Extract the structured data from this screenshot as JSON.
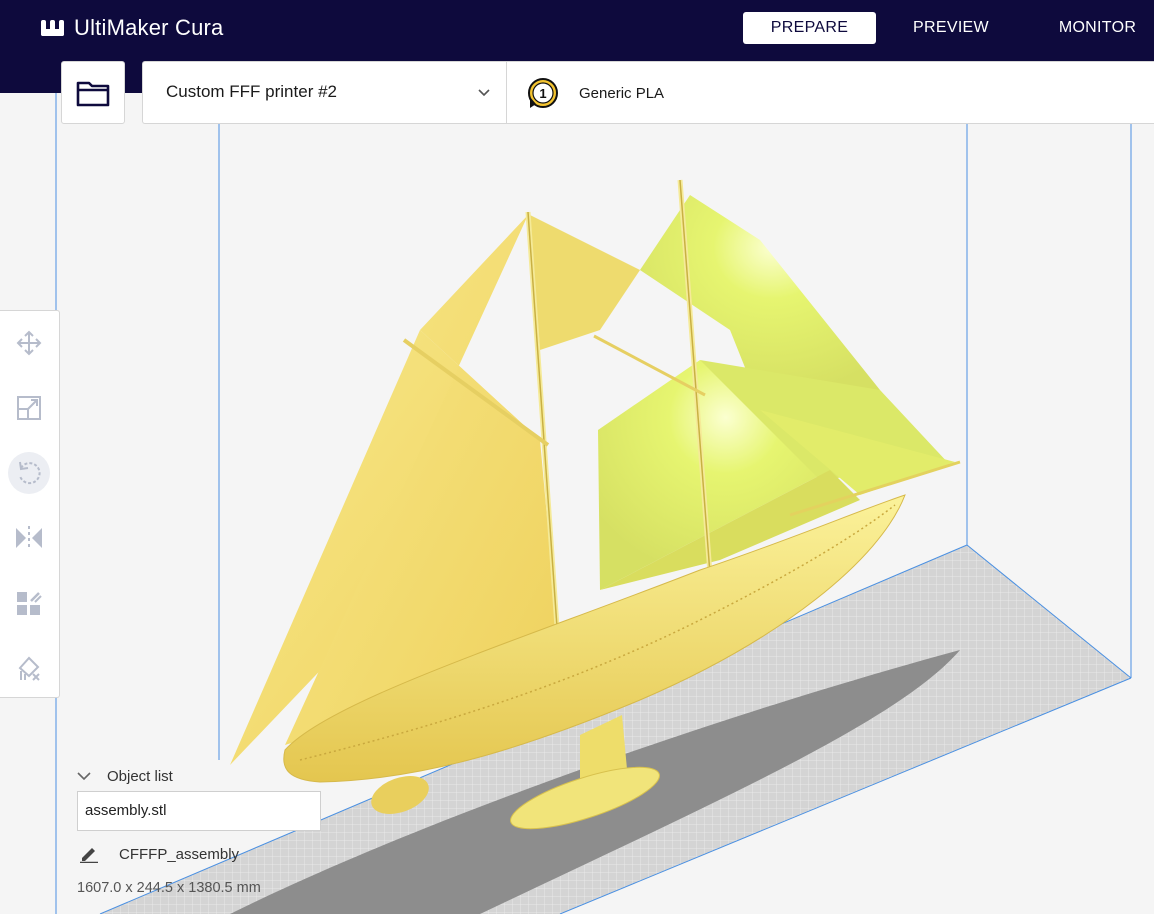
{
  "app": {
    "logo_text": "UltiMaker Cura",
    "logo_icon": "ultimaker-logo-icon"
  },
  "stages": [
    {
      "label": "PREPARE",
      "active": true
    },
    {
      "label": "PREVIEW",
      "active": false
    },
    {
      "label": "MONITOR",
      "active": false
    }
  ],
  "toolbar_top": {
    "open_icon": "folder-icon",
    "printer": {
      "name": "Custom FFF printer #2",
      "icon": "chevron-down-icon"
    },
    "material": {
      "extruder_number": "1",
      "name": "Generic PLA"
    }
  },
  "left_tools": [
    {
      "icon": "move-icon"
    },
    {
      "icon": "scale-icon"
    },
    {
      "icon": "rotate-icon",
      "selected": true
    },
    {
      "icon": "mirror-icon"
    },
    {
      "icon": "per-model-settings-icon"
    },
    {
      "icon": "support-blocker-icon"
    }
  ],
  "object_list": {
    "header": "Object list",
    "items": [
      "assembly.stl"
    ]
  },
  "job": {
    "name": "CFFFP_assembly",
    "dimensions": "1607.0 x 244.5 x 1380.5 mm"
  },
  "colors": {
    "header_bg": "#0e0a3d",
    "model_yellow": "#f2e36c",
    "build_volume_line": "#4a90e2",
    "shadow": "#8a8a8a"
  }
}
